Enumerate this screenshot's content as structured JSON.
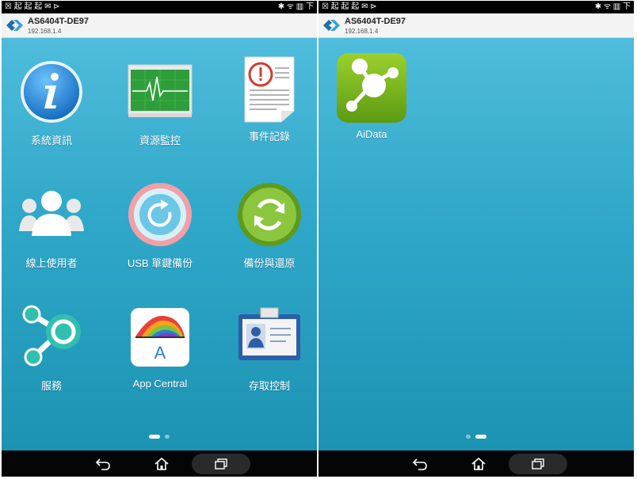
{
  "screens": [
    {
      "status": {
        "left": "☒ 起 起 起 ✉ ⊳",
        "right": "✱ ᯤ ▥ 下"
      },
      "header": {
        "device_name": "AS6404T-DE97",
        "device_ip": "192.168.1.4"
      },
      "apps": [
        {
          "label": "系統資訊",
          "icon": "info-icon"
        },
        {
          "label": "資源監控",
          "icon": "resource-monitor-icon"
        },
        {
          "label": "事件記錄",
          "icon": "event-log-icon"
        },
        {
          "label": "線上使用者",
          "icon": "online-users-icon"
        },
        {
          "label": "USB 單鍵備份",
          "icon": "usb-backup-icon"
        },
        {
          "label": "備份與還原",
          "icon": "backup-restore-icon"
        },
        {
          "label": "服務",
          "icon": "services-icon"
        },
        {
          "label": "App Central",
          "icon": "app-central-icon"
        },
        {
          "label": "存取控制",
          "icon": "access-control-icon"
        }
      ],
      "active_page": 1
    },
    {
      "status": {
        "left": "☒ 起 起 起 ✉ ⊳",
        "right": "✱ ᯤ ▥ 下"
      },
      "header": {
        "device_name": "AS6404T-DE97",
        "device_ip": "192.168.1.4"
      },
      "apps": [
        {
          "label": "AiData",
          "icon": "aidata-icon"
        }
      ],
      "active_page": 2
    }
  ],
  "navbar": {
    "icons": [
      "back-icon",
      "home-icon",
      "recent-apps-icon"
    ]
  },
  "colors": {
    "bg_top": "#4fbcdc",
    "bg_bottom": "#1c93b3",
    "header_bg": "#f3f3f3"
  }
}
